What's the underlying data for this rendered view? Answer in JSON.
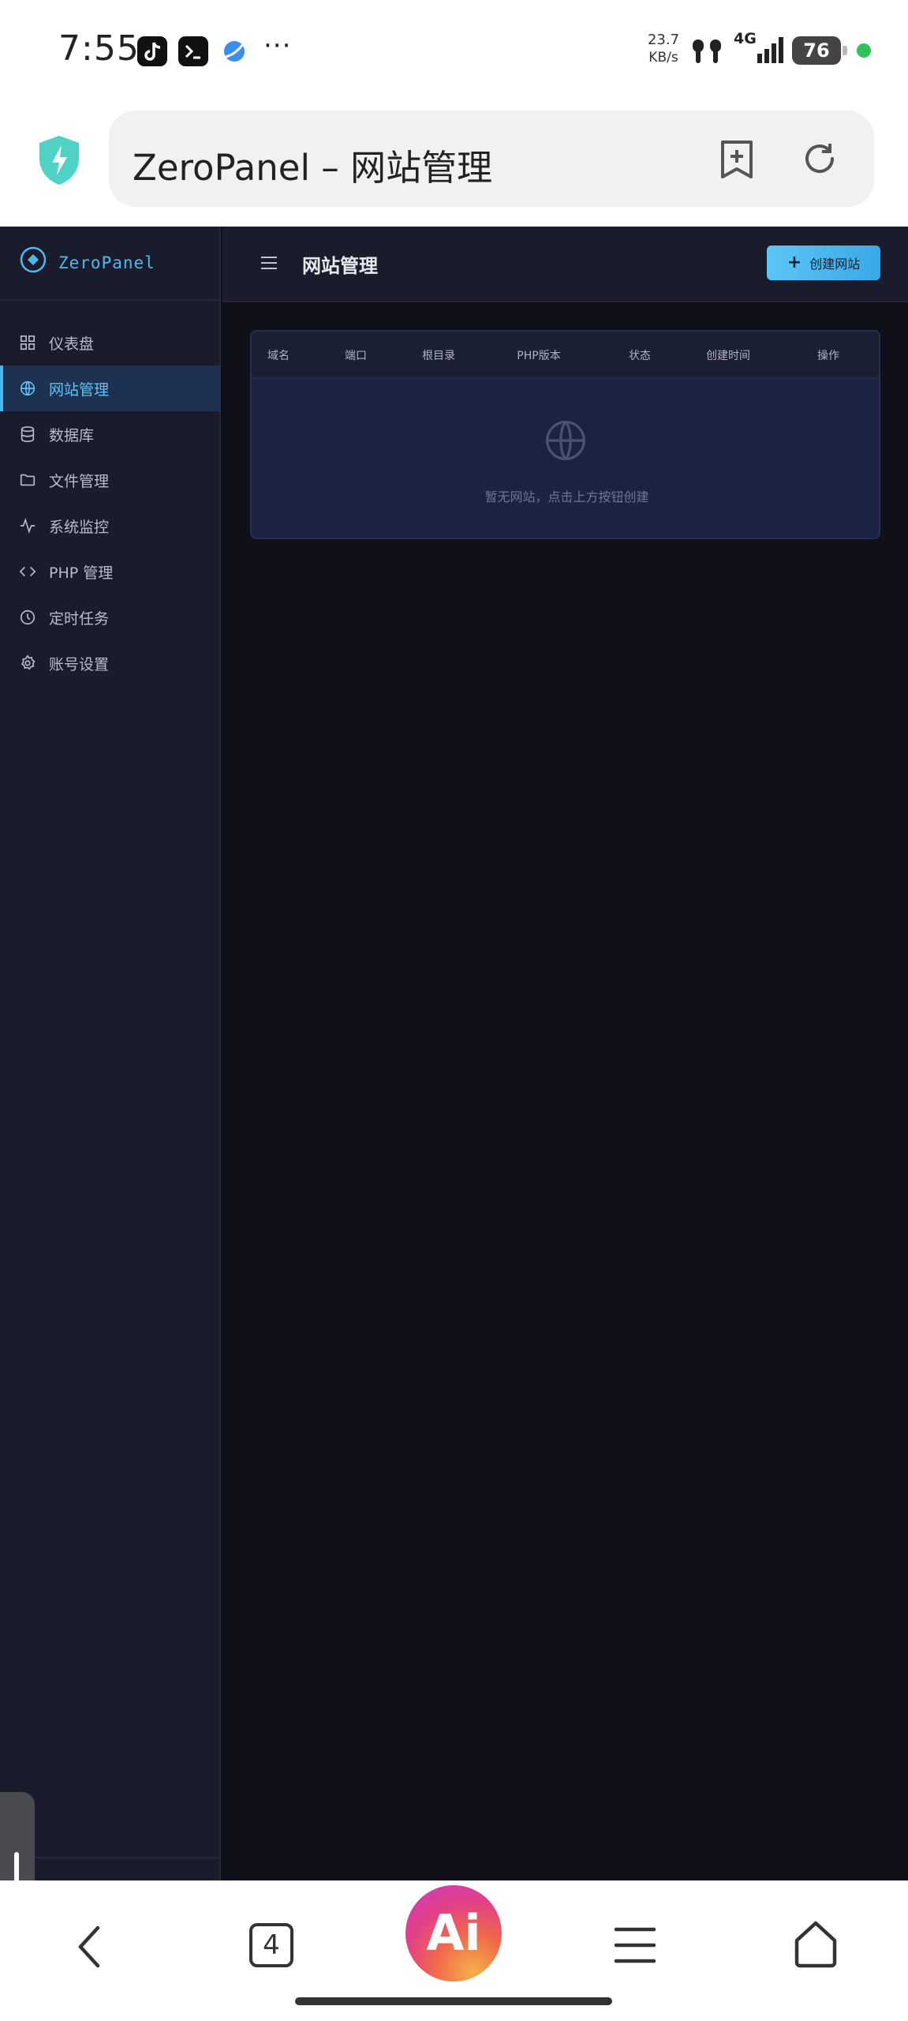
{
  "status_bar": {
    "time": "7:55",
    "more": "···",
    "net_speed": "23.7",
    "net_speed_unit": "KB/s",
    "network": "4G",
    "battery": "76"
  },
  "browser": {
    "tab_title": "ZeroPanel – 网站管理",
    "tab_count": "4",
    "ai_label": "Ai"
  },
  "app": {
    "brand": "ZeroPanel",
    "sidebar": {
      "items": [
        {
          "label": "仪表盘",
          "icon": "grid-icon"
        },
        {
          "label": "网站管理",
          "icon": "globe-icon",
          "active": true
        },
        {
          "label": "数据库",
          "icon": "database-icon"
        },
        {
          "label": "文件管理",
          "icon": "folder-icon"
        },
        {
          "label": "系统监控",
          "icon": "activity-icon"
        },
        {
          "label": "PHP 管理",
          "icon": "code-icon"
        },
        {
          "label": "定时任务",
          "icon": "clock-icon"
        },
        {
          "label": "账号设置",
          "icon": "gear-icon"
        }
      ]
    },
    "header": {
      "title": "网站管理",
      "create_button": "创建网站"
    },
    "table": {
      "columns": [
        "域名",
        "端口",
        "根目录",
        "PHP版本",
        "状态",
        "创建时间",
        "操作"
      ],
      "rows": [],
      "empty_text": "暂无网站，点击上方按钮创建"
    }
  },
  "colors": {
    "accent": "#4ab6f0",
    "sidebar_bg": "#1a1c2c",
    "content_bg": "#0f1019",
    "card_bg": "#1a2442"
  }
}
